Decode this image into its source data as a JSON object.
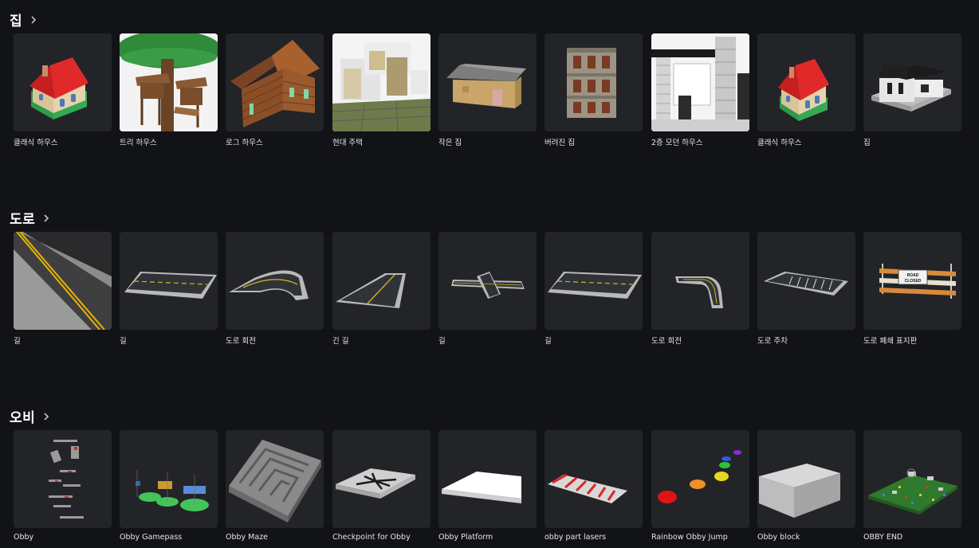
{
  "sections": [
    {
      "title": "집",
      "items": [
        {
          "label": "클래식 하우스",
          "icon": "classic-house-icon"
        },
        {
          "label": "트리 하우스",
          "icon": "tree-house-icon"
        },
        {
          "label": "로그 하우스",
          "icon": "log-house-icon"
        },
        {
          "label": "현대 주택",
          "icon": "modern-house-icon"
        },
        {
          "label": "작은 집",
          "icon": "small-house-icon"
        },
        {
          "label": "버려진 집",
          "icon": "abandoned-house-icon"
        },
        {
          "label": "2층 모던 하우스",
          "icon": "two-story-modern-house-icon"
        },
        {
          "label": "클래식 하우스",
          "icon": "classic-house-icon"
        },
        {
          "label": "집",
          "icon": "house-icon"
        }
      ]
    },
    {
      "title": "도로",
      "items": [
        {
          "label": "길",
          "icon": "road-perspective-icon"
        },
        {
          "label": "길",
          "icon": "road-straight-icon"
        },
        {
          "label": "도로 회전",
          "icon": "road-turn-icon"
        },
        {
          "label": "긴 길",
          "icon": "long-road-icon"
        },
        {
          "label": "길",
          "icon": "road-intersection-icon"
        },
        {
          "label": "길",
          "icon": "road-straight-icon"
        },
        {
          "label": "도로 회전",
          "icon": "road-turn-icon"
        },
        {
          "label": "도로 주차",
          "icon": "road-parking-icon"
        },
        {
          "label": "도로 폐쇄 표지판",
          "icon": "road-closed-sign-icon"
        }
      ]
    },
    {
      "title": "오비",
      "items": [
        {
          "label": "Obby",
          "icon": "obby-course-icon"
        },
        {
          "label": "Obby Gamepass",
          "icon": "obby-gamepass-icon"
        },
        {
          "label": "Obby Maze",
          "icon": "obby-maze-icon"
        },
        {
          "label": "Checkpoint for Obby",
          "icon": "checkpoint-icon"
        },
        {
          "label": "Obby Platform",
          "icon": "obby-platform-icon"
        },
        {
          "label": "obby part lasers",
          "icon": "obby-lasers-icon"
        },
        {
          "label": "Rainbow Obby Jump",
          "icon": "rainbow-jump-icon"
        },
        {
          "label": "Obby block",
          "icon": "obby-block-icon"
        },
        {
          "label": "OBBY END",
          "icon": "obby-end-icon"
        }
      ]
    }
  ],
  "road_sign_text": "ROAD CLOSED"
}
